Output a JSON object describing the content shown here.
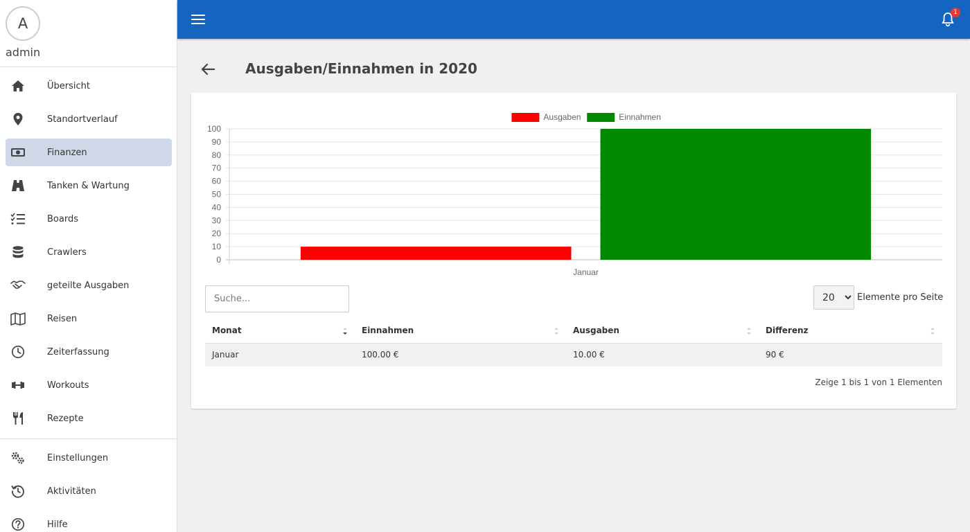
{
  "user": {
    "avatar_letter": "A",
    "name": "admin"
  },
  "nav": {
    "main": [
      {
        "label": "Übersicht",
        "icon": "home-icon"
      },
      {
        "label": "Standortverlauf",
        "icon": "map-pin-icon"
      },
      {
        "label": "Finanzen",
        "icon": "money-icon",
        "active": true
      },
      {
        "label": "Tanken & Wartung",
        "icon": "car-icon"
      },
      {
        "label": "Boards",
        "icon": "checklist-icon"
      },
      {
        "label": "Crawlers",
        "icon": "database-icon"
      },
      {
        "label": "geteilte Ausgaben",
        "icon": "handshake-icon"
      },
      {
        "label": "Reisen",
        "icon": "map-icon"
      },
      {
        "label": "Zeiterfassung",
        "icon": "clock-icon"
      },
      {
        "label": "Workouts",
        "icon": "dumbbell-icon"
      },
      {
        "label": "Rezepte",
        "icon": "utensils-icon"
      }
    ],
    "secondary": [
      {
        "label": "Einstellungen",
        "icon": "gears-icon"
      },
      {
        "label": "Aktivitäten",
        "icon": "history-icon"
      },
      {
        "label": "Hilfe",
        "icon": "help-icon"
      }
    ]
  },
  "topbar": {
    "notification_count": "1",
    "accent": "#1565c0"
  },
  "page": {
    "title": "Ausgaben/Einnahmen in 2020"
  },
  "chart_data": {
    "type": "bar",
    "categories": [
      "Januar"
    ],
    "series": [
      {
        "name": "Ausgaben",
        "values": [
          10
        ],
        "color": "#ff0000"
      },
      {
        "name": "Einnahmen",
        "values": [
          100
        ],
        "color": "#008800"
      }
    ],
    "ylim": [
      0,
      100
    ],
    "yticks": [
      0,
      10,
      20,
      30,
      40,
      50,
      60,
      70,
      80,
      90,
      100
    ],
    "legend": "top",
    "grid": true
  },
  "controls": {
    "search_placeholder": "Suche...",
    "per_page_options": [
      "20"
    ],
    "per_page_selected": "20",
    "per_page_label": "Elemente pro Seite"
  },
  "table": {
    "columns": [
      "Monat",
      "Einnahmen",
      "Ausgaben",
      "Differenz"
    ],
    "rows": [
      [
        "Januar",
        "100.00 €",
        "10.00 €",
        "90 €"
      ]
    ],
    "info": "Zeige 1 bis 1 von 1 Elementen"
  }
}
